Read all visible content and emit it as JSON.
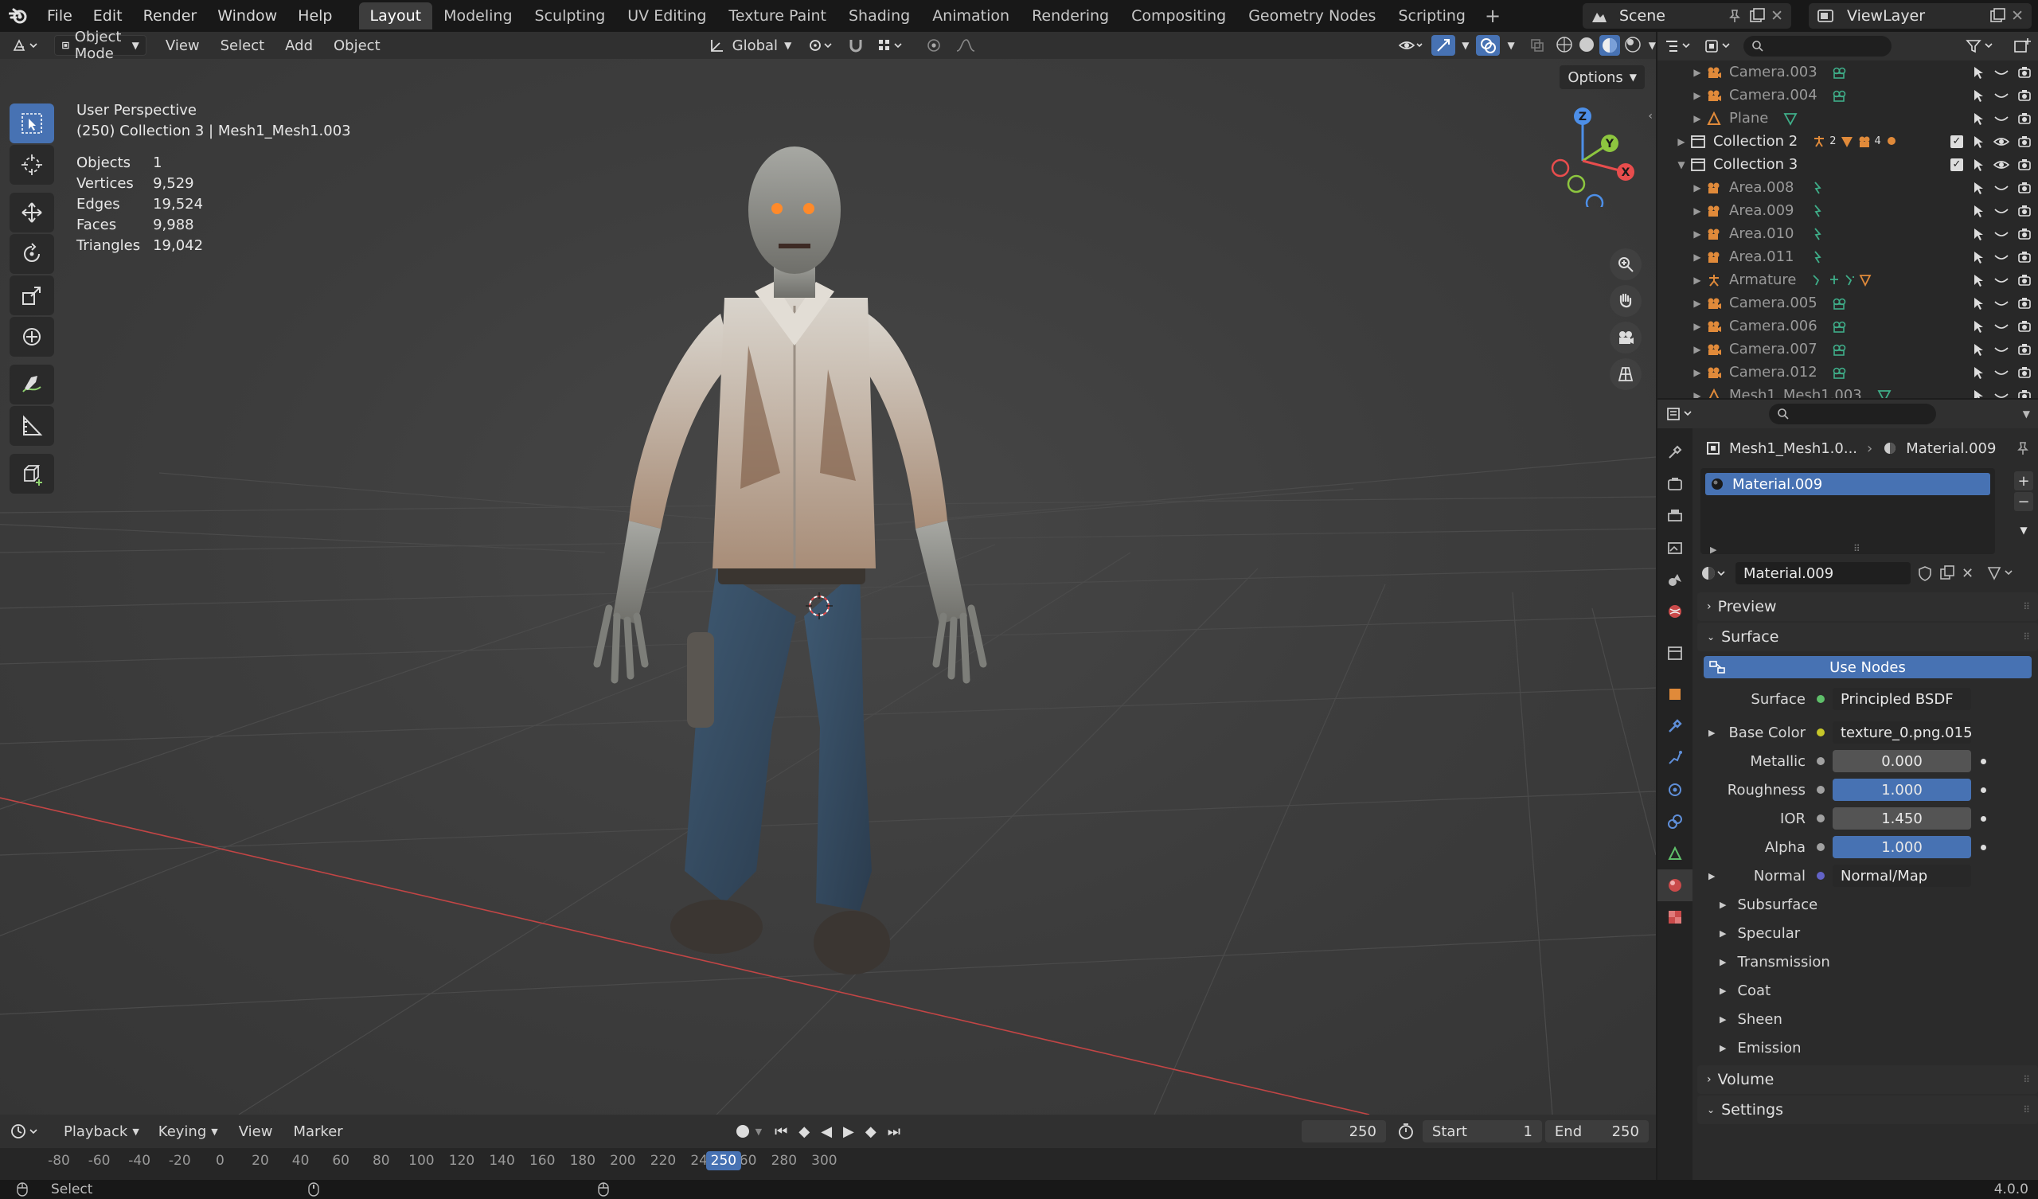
{
  "topbar": {
    "menus": [
      "File",
      "Edit",
      "Render",
      "Window",
      "Help"
    ],
    "workspaces": [
      "Layout",
      "Modeling",
      "Sculpting",
      "UV Editing",
      "Texture Paint",
      "Shading",
      "Animation",
      "Rendering",
      "Compositing",
      "Geometry Nodes",
      "Scripting"
    ],
    "active_workspace": "Layout",
    "scene": "Scene",
    "view_layer": "ViewLayer"
  },
  "viewport_header": {
    "mode": "Object Mode",
    "menus": [
      "View",
      "Select",
      "Add",
      "Object"
    ],
    "transform_orientation": "Global",
    "options_label": "Options"
  },
  "viewport": {
    "view_name": "User Perspective",
    "context": "(250) Collection 3 | Mesh1_Mesh1.003",
    "stats": [
      {
        "label": "Objects",
        "value": "1"
      },
      {
        "label": "Vertices",
        "value": "9,529"
      },
      {
        "label": "Edges",
        "value": "19,524"
      },
      {
        "label": "Faces",
        "value": "9,988"
      },
      {
        "label": "Triangles",
        "value": "19,042"
      }
    ],
    "gizmo_axes": [
      "Z",
      "Y",
      "X"
    ]
  },
  "outliner": {
    "rows": [
      {
        "name": "Camera.003",
        "type": "camera"
      },
      {
        "name": "Camera.004",
        "type": "camera"
      },
      {
        "name": "Plane",
        "type": "mesh"
      },
      {
        "name": "Collection 2",
        "type": "collection",
        "badges": [
          "2",
          "4"
        ]
      },
      {
        "name": "Collection 3",
        "type": "collection"
      },
      {
        "name": "Area.008",
        "type": "light"
      },
      {
        "name": "Area.009",
        "type": "light"
      },
      {
        "name": "Area.010",
        "type": "light"
      },
      {
        "name": "Area.011",
        "type": "light"
      },
      {
        "name": "Armature",
        "type": "armature"
      },
      {
        "name": "Camera.005",
        "type": "camera"
      },
      {
        "name": "Camera.006",
        "type": "camera"
      },
      {
        "name": "Camera.007",
        "type": "camera"
      },
      {
        "name": "Camera.012",
        "type": "camera"
      },
      {
        "name": "Mesh1_Mesh1.003",
        "type": "mesh"
      }
    ]
  },
  "properties": {
    "breadcrumb_object": "Mesh1_Mesh1.0...",
    "breadcrumb_material": "Material.009",
    "slot_name": "Material.009",
    "material_name": "Material.009",
    "panels": {
      "preview": "Preview",
      "surface": "Surface",
      "use_nodes": "Use Nodes",
      "volume": "Volume",
      "settings": "Settings"
    },
    "surface_label": "Surface",
    "surface_value": "Principled BSDF",
    "inputs": [
      {
        "label": "Base Color",
        "value": "texture_0.png.015",
        "kind": "link",
        "dot": "#c7c729"
      },
      {
        "label": "Metallic",
        "value": "0.000",
        "kind": "slider",
        "fill": 0,
        "dot": "#a1a1a1"
      },
      {
        "label": "Roughness",
        "value": "1.000",
        "kind": "slider",
        "fill": 1,
        "dot": "#a1a1a1"
      },
      {
        "label": "IOR",
        "value": "1.450",
        "kind": "slider",
        "fill": 0,
        "dot": "#a1a1a1"
      },
      {
        "label": "Alpha",
        "value": "1.000",
        "kind": "slider",
        "fill": 1,
        "dot": "#a1a1a1"
      },
      {
        "label": "Normal",
        "value": "Normal/Map",
        "kind": "link",
        "dot": "#6363c7"
      }
    ],
    "subsections": [
      "Subsurface",
      "Specular",
      "Transmission",
      "Coat",
      "Sheen",
      "Emission"
    ]
  },
  "timeline": {
    "menus": [
      "Playback",
      "Keying",
      "View",
      "Marker"
    ],
    "current_frame": "250",
    "start_label": "Start",
    "start_value": "1",
    "end_label": "End",
    "end_value": "250",
    "ruler_ticks": [
      "-80",
      "-60",
      "-40",
      "-20",
      "0",
      "20",
      "40",
      "60",
      "80",
      "100",
      "120",
      "140",
      "160",
      "180",
      "200",
      "220",
      "240",
      "260",
      "280",
      "300"
    ],
    "playhead_label": "250"
  },
  "statusbar": {
    "left": "Select",
    "version": "4.0.0"
  },
  "colors": {
    "accent": "#4772b3",
    "x_axis": "#e84d4d",
    "y_axis": "#8dc63f",
    "z_axis": "#4d8fe8"
  }
}
